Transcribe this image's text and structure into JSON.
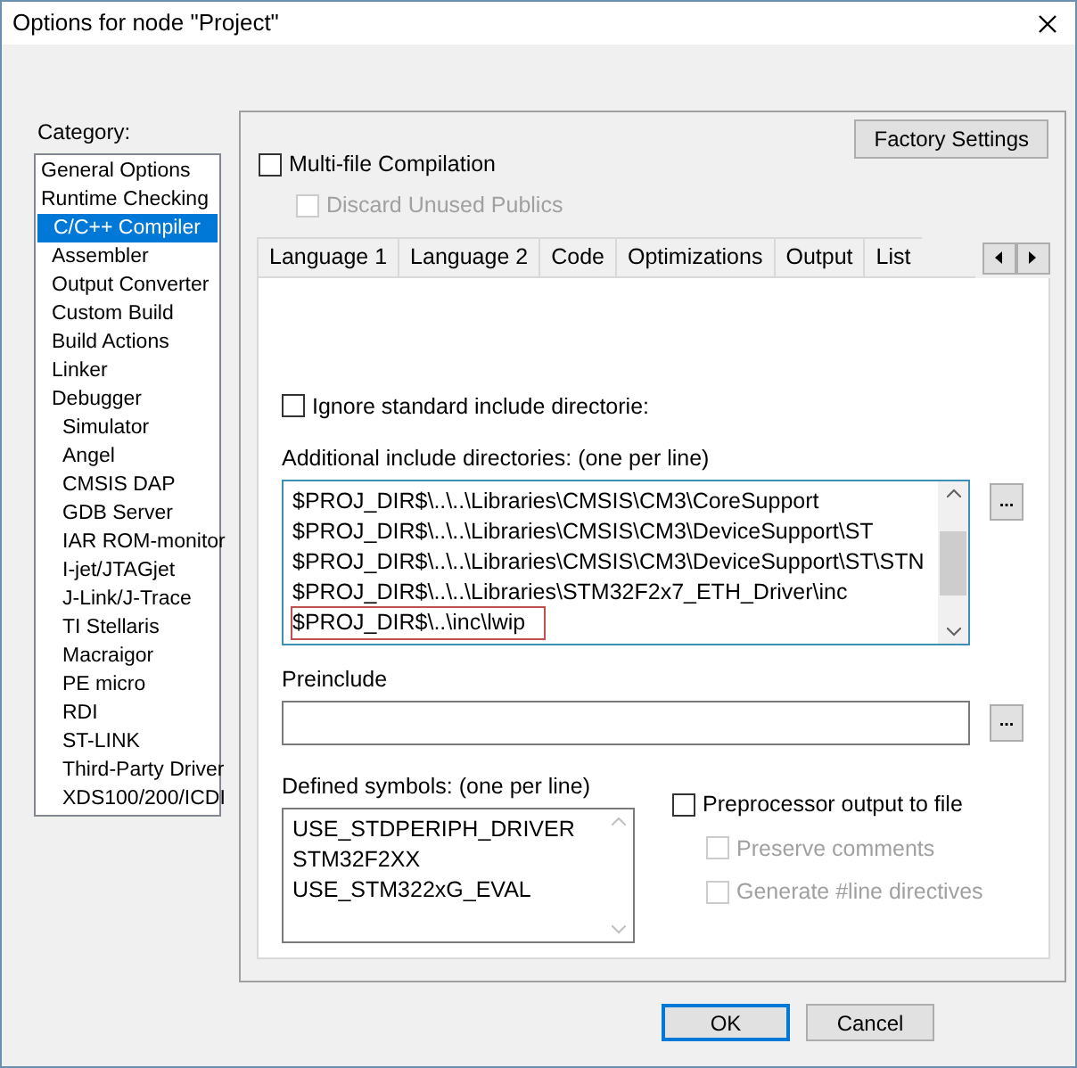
{
  "window": {
    "title": "Options for node \"Project\""
  },
  "category": {
    "label": "Category:",
    "items": [
      {
        "label": "General Options",
        "kind": "general",
        "selected": false
      },
      {
        "label": "Runtime Checking",
        "kind": "general",
        "selected": false
      },
      {
        "label": "C/C++ Compiler",
        "kind": "tool",
        "selected": true
      },
      {
        "label": "Assembler",
        "kind": "tool",
        "selected": false
      },
      {
        "label": "Output Converter",
        "kind": "tool",
        "selected": false
      },
      {
        "label": "Custom Build",
        "kind": "tool",
        "selected": false
      },
      {
        "label": "Build Actions",
        "kind": "tool",
        "selected": false
      },
      {
        "label": "Linker",
        "kind": "tool",
        "selected": false
      },
      {
        "label": "Debugger",
        "kind": "tool",
        "selected": false,
        "children": [
          {
            "label": "Simulator",
            "selected": false
          },
          {
            "label": "Angel",
            "selected": false
          },
          {
            "label": "CMSIS DAP",
            "selected": false
          },
          {
            "label": "GDB Server",
            "selected": false
          },
          {
            "label": "IAR ROM-monitor",
            "selected": false
          },
          {
            "label": "I-jet/JTAGjet",
            "selected": false
          },
          {
            "label": "J-Link/J-Trace",
            "selected": false
          },
          {
            "label": "TI Stellaris",
            "selected": false
          },
          {
            "label": "Macraigor",
            "selected": false
          },
          {
            "label": "PE micro",
            "selected": false
          },
          {
            "label": "RDI",
            "selected": false
          },
          {
            "label": "ST-LINK",
            "selected": false
          },
          {
            "label": "Third-Party Driver",
            "selected": false
          },
          {
            "label": "XDS100/200/ICDI",
            "selected": false
          }
        ]
      }
    ]
  },
  "factory_settings_button": "Factory Settings",
  "multi_file": {
    "label": "Multi-file Compilation",
    "checked": false,
    "disabled": false
  },
  "discard_publics": {
    "label": "Discard Unused Publics",
    "checked": false,
    "disabled": true
  },
  "tabs": [
    {
      "label": "Language 1",
      "selected": false
    },
    {
      "label": "Language 2",
      "selected": false
    },
    {
      "label": "Code",
      "selected": false
    },
    {
      "label": "Optimizations",
      "selected": false
    },
    {
      "label": "Output",
      "selected": false
    },
    {
      "label": "List",
      "selected": false
    }
  ],
  "ignore_standard": {
    "label": "Ignore standard include directorie:",
    "checked": false,
    "disabled": false
  },
  "include_dirs": {
    "label": "Additional include directories: (one per line)",
    "lines": [
      {
        "text": "$PROJ_DIR$\\..\\..\\Libraries\\CMSIS\\CM3\\CoreSupport",
        "highlighted": false
      },
      {
        "text": "$PROJ_DIR$\\..\\..\\Libraries\\CMSIS\\CM3\\DeviceSupport\\ST",
        "highlighted": false
      },
      {
        "text": "$PROJ_DIR$\\..\\..\\Libraries\\CMSIS\\CM3\\DeviceSupport\\ST\\STN",
        "highlighted": false
      },
      {
        "text": "$PROJ_DIR$\\..\\..\\Libraries\\STM32F2x7_ETH_Driver\\inc",
        "highlighted": false
      },
      {
        "text": "$PROJ_DIR$\\..\\inc\\lwip",
        "highlighted": true
      }
    ],
    "browse": "..."
  },
  "preinclude": {
    "label": "Preinclude",
    "browse": "..."
  },
  "defined_symbols": {
    "label": "Defined symbols: (one per line)",
    "lines": [
      "USE_STDPERIPH_DRIVER",
      "STM32F2XX",
      "USE_STM322xG_EVAL"
    ]
  },
  "preprocessor_output": {
    "label": "Preprocessor output to file",
    "checked": false,
    "disabled": false
  },
  "preserve_comments": {
    "label": "Preserve comments",
    "checked": false,
    "disabled": true
  },
  "generate_line": {
    "label": "Generate #line directives",
    "checked": false,
    "disabled": true
  },
  "buttons": [
    {
      "label": "OK",
      "default": true
    },
    {
      "label": "Cancel",
      "default": false
    }
  ]
}
